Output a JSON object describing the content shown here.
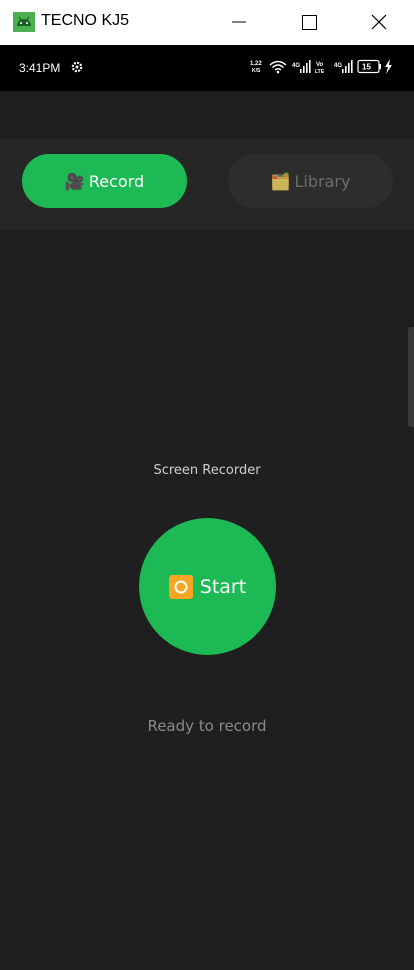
{
  "window": {
    "title": "TECNO KJ5"
  },
  "statusbar": {
    "time": "3:41PM",
    "net_speed_value": "1.22",
    "net_speed_unit": "K/S",
    "network_1": "4G",
    "volte_top": "Vo",
    "volte_bottom": "LTE",
    "network_2": "4G",
    "battery": "15"
  },
  "tabs": {
    "record": {
      "label": "Record",
      "icon": "🎥"
    },
    "library": {
      "label": "Library",
      "icon": "🗂️"
    }
  },
  "main": {
    "heading": "Screen Recorder",
    "start_icon": "record-button-icon",
    "start_label": "Start",
    "status": "Ready to record"
  },
  "colors": {
    "accent": "#1db954",
    "background": "#1f1f1f",
    "tabbar": "#262626",
    "tab_inactive": "#2d2d2d",
    "record_icon": "#f5a623"
  }
}
